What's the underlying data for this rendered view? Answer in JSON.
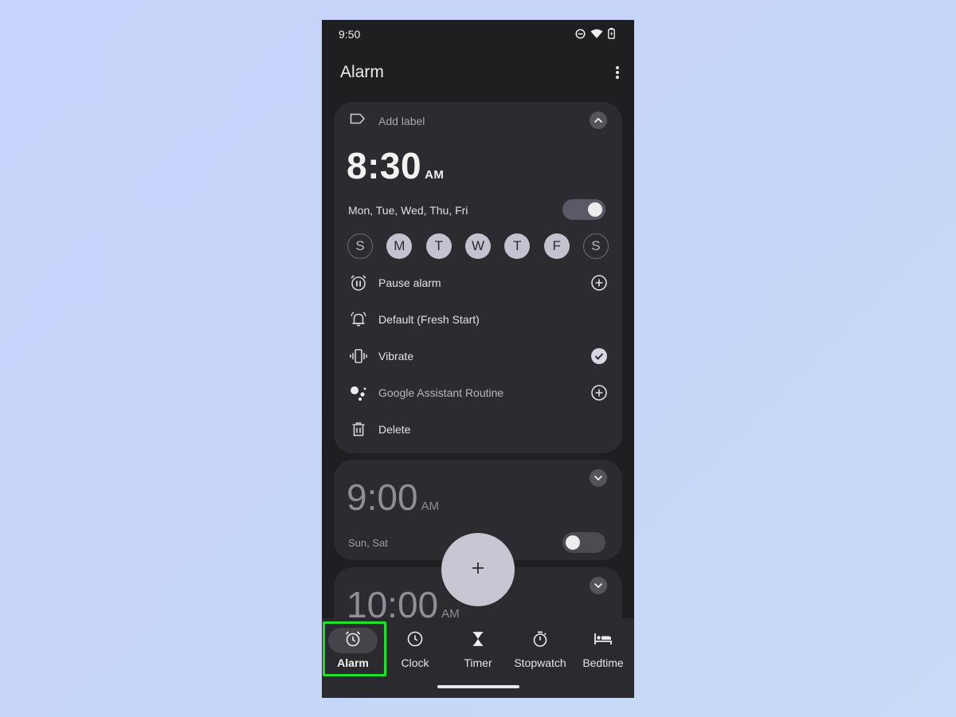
{
  "status_bar": {
    "time": "9:50"
  },
  "app_bar": {
    "title": "Alarm"
  },
  "alarms": [
    {
      "label_placeholder": "Add label",
      "time": "8:30",
      "ampm": "AM",
      "repeat_text": "Mon, Tue, Wed, Thu, Fri",
      "enabled": true,
      "expanded": true,
      "days": [
        "S",
        "M",
        "T",
        "W",
        "T",
        "F",
        "S"
      ],
      "days_selected": [
        false,
        true,
        true,
        true,
        true,
        true,
        false
      ],
      "options": {
        "pause": "Pause alarm",
        "ringtone": "Default (Fresh Start)",
        "vibrate": "Vibrate",
        "assistant": "Google Assistant Routine",
        "delete": "Delete"
      }
    },
    {
      "time": "9:00",
      "ampm": "AM",
      "repeat_text": "Sun, Sat",
      "enabled": false
    },
    {
      "time": "10:00",
      "ampm": "AM"
    }
  ],
  "fab": {
    "symbol": "+"
  },
  "nav": [
    {
      "label": "Alarm",
      "icon": "alarm-icon",
      "active": true
    },
    {
      "label": "Clock",
      "icon": "clock-icon"
    },
    {
      "label": "Timer",
      "icon": "hourglass-icon"
    },
    {
      "label": "Stopwatch",
      "icon": "stopwatch-icon"
    },
    {
      "label": "Bedtime",
      "icon": "bed-icon"
    }
  ],
  "colors": {
    "highlight": "#22e12b",
    "background": "#1f1f21",
    "card": "#2b2b30"
  }
}
